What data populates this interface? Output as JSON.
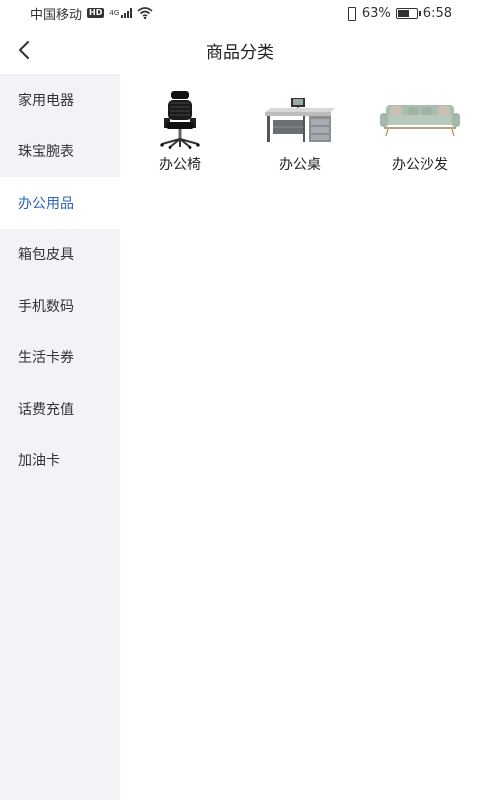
{
  "status_bar": {
    "carrier": "中国移动",
    "hd": "HD",
    "network": "4G",
    "battery_percent": "63%",
    "battery_level": 0.63,
    "time": "6:58"
  },
  "header": {
    "title": "商品分类",
    "back_icon": "chevron-left-icon"
  },
  "sidebar": {
    "active_index": 2,
    "items": [
      {
        "label": "家用电器"
      },
      {
        "label": "珠宝腕表"
      },
      {
        "label": "办公用品"
      },
      {
        "label": "箱包皮具"
      },
      {
        "label": "手机数码"
      },
      {
        "label": "生活卡券"
      },
      {
        "label": "话费充值"
      },
      {
        "label": "加油卡"
      }
    ]
  },
  "products": [
    {
      "label": "办公椅",
      "image": "office-chair"
    },
    {
      "label": "办公桌",
      "image": "office-desk"
    },
    {
      "label": "办公沙发",
      "image": "office-sofa"
    }
  ],
  "colors": {
    "accent": "#2a62b8",
    "sidebar_bg": "#f2f3f7",
    "background": "#ffffff"
  }
}
